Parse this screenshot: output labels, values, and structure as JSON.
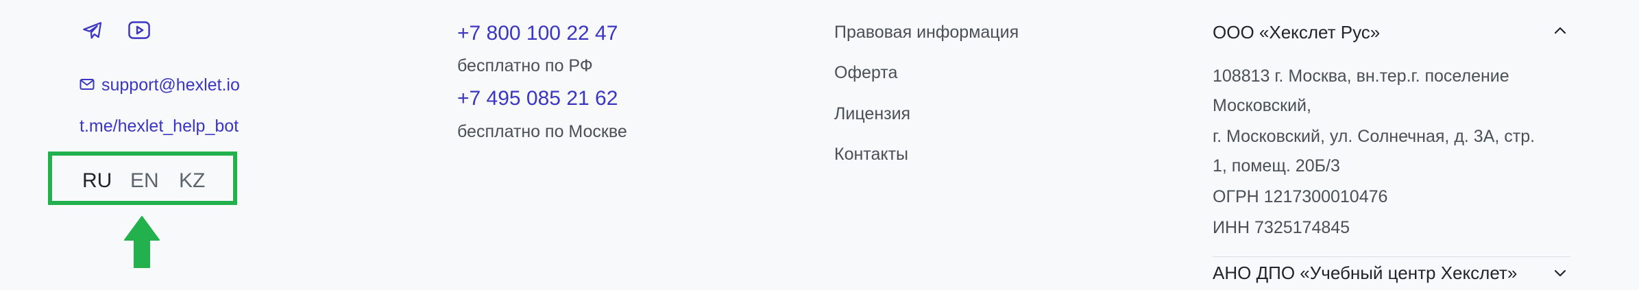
{
  "social": {
    "telegram_icon": "telegram-icon",
    "youtube_icon": "youtube-icon"
  },
  "contacts": {
    "email": "support@hexlet.io",
    "bot_link": "t.me/hexlet_help_bot"
  },
  "languages": [
    {
      "label": "RU",
      "active": true
    },
    {
      "label": "EN",
      "active": false
    },
    {
      "label": "KZ",
      "active": false
    }
  ],
  "phones": [
    {
      "number": "+7 800 100 22 47",
      "note": "бесплатно по РФ"
    },
    {
      "number": "+7 495 085 21 62",
      "note": "бесплатно по Москве"
    }
  ],
  "legal_links": [
    "Правовая информация",
    "Оферта",
    "Лицензия",
    "Контакты"
  ],
  "company": {
    "title": "ООО «Хекслет Рус»",
    "expanded": true,
    "address_lines": [
      "108813 г. Москва, вн.тер.г. поселение",
      "Московский,",
      "г. Московский, ул. Солнечная, д. 3А, стр.",
      "1, помещ. 20Б/3",
      "ОГРН 1217300010476",
      "ИНН 7325174845"
    ]
  },
  "company2": {
    "title": "АНО ДПО «Учебный центр Хекслет»",
    "expanded": false
  },
  "colors": {
    "link": "#3b35c3",
    "highlight": "#22b14c",
    "background": "#f8f9fa"
  }
}
